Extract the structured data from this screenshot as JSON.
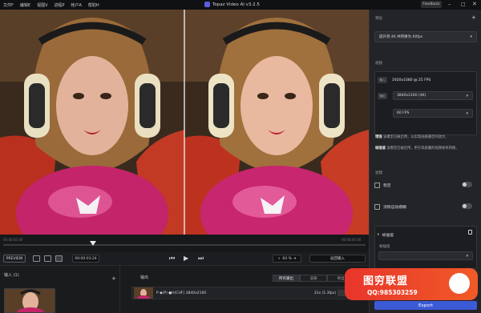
{
  "menu": [
    "文件F",
    "编辑E",
    "视图V",
    "进程P",
    "帐户A",
    "帮助H"
  ],
  "app": {
    "title": "Topaz Video AI  v3.2.5"
  },
  "feedback_label": "Feedback",
  "timeline": {
    "start_label": "00:00:00.00",
    "end_label": "00:00:00.00"
  },
  "controls": {
    "preview_label": "PREVIEW",
    "timecode": "00:00:03:24",
    "zoom": "64 %",
    "compare_label": "返回输入"
  },
  "inputs": {
    "title": "输入 (1)"
  },
  "outputs": {
    "title": "输出",
    "tabs": [
      "所有输出",
      "渲染",
      "导出"
    ],
    "row_text": "P  ◆(P)  ●H(CHF)  3840x2160",
    "row_fps": "31x (1.3fps)"
  },
  "sidebar": {
    "preset_section": "预设",
    "preset_value": "提升到 4K 并转换为 60fps",
    "video_section": "视频",
    "input_label": "输入",
    "input_value": "1920x1080 @ 25 FPS",
    "output_label": "输出",
    "resolution_value": "3840x2160 (4K)",
    "fps_value": "60 FPS",
    "note1_bold": "增强",
    "note1_text": " 该模型已被启用，以实现画质最佳的放大。",
    "note2_bold": "帧插值",
    "note2_text": " 该模型已被启用，用于高质量的视频帧率转换。",
    "filters_section": "滤镜",
    "stabilize_label": "稳定",
    "motion_deblur_label": "消除运动模糊",
    "interp_label": "帧插值",
    "interp_model_label": "帧插值",
    "export_label": "Export"
  },
  "watermark": {
    "title": "图穷联盟",
    "qq": "QQ:985303259"
  },
  "colors": {
    "accent": "#3b5bd6",
    "background": "#1a1b1d",
    "sidebar": "#232427",
    "watermark": "#e8352b"
  }
}
